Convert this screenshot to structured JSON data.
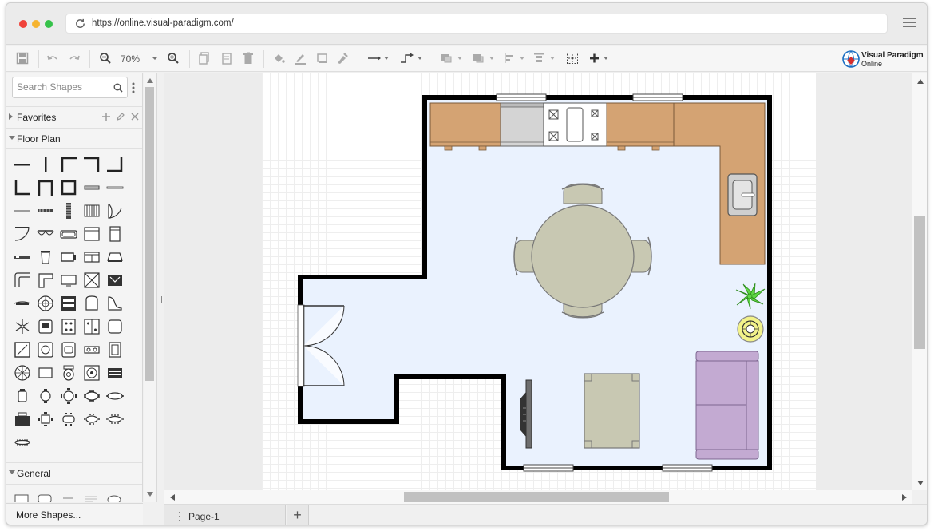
{
  "browser": {
    "url": "https://online.visual-paradigm.com/",
    "reload_icon": "reload-icon",
    "menu_icon": "hamburger-menu-icon"
  },
  "toolbar": {
    "zoom_level": "70%",
    "brand_line1": "Visual Paradigm",
    "brand_line2": "Online"
  },
  "sidebar": {
    "search_placeholder": "Search Shapes",
    "sections": [
      {
        "label": "Favorites"
      },
      {
        "label": "Floor Plan"
      },
      {
        "label": "General"
      }
    ],
    "more_shapes": "More Shapes..."
  },
  "pages": {
    "current": "Page-1"
  },
  "colors": {
    "floor": "#eaf2fe",
    "wall": "#000000",
    "counter": "#d4a373",
    "table": "#c8c8b2",
    "sofa": "#c3aad2",
    "plant": "#5ed644"
  }
}
